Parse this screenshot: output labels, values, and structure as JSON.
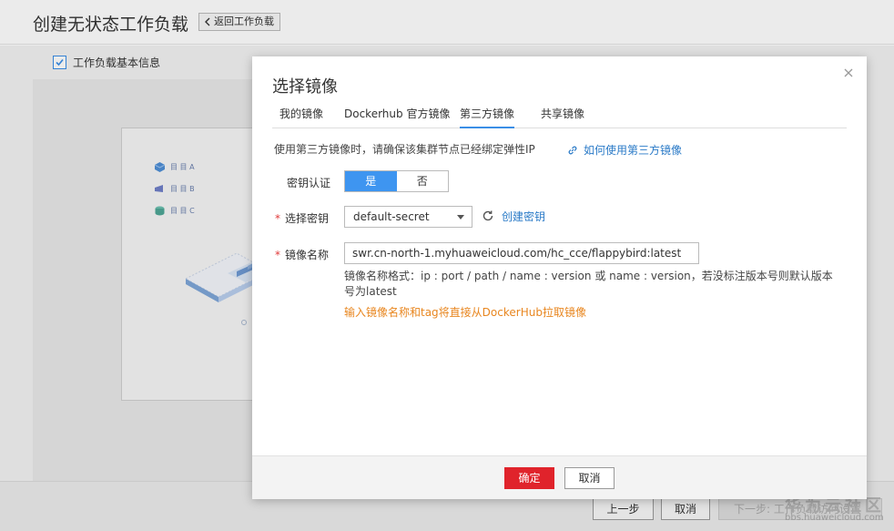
{
  "page": {
    "title": "创建无状态工作负载",
    "back_label": "返回工作负载",
    "step_label": "工作负载基本信息",
    "legend": [
      "目 目 A",
      "目 目 B",
      "目 目 C"
    ],
    "footer": {
      "prev_label": "上一步",
      "cancel_label": "取消",
      "next_label": "下一步: 工作负载访问设置"
    }
  },
  "watermark": {
    "main": "华为云社区",
    "sub": "bbs.huaweicloud.com"
  },
  "modal": {
    "title": "选择镜像",
    "tabs": [
      {
        "label": "我的镜像",
        "active": false
      },
      {
        "label": "Dockerhub 官方镜像",
        "active": false
      },
      {
        "label": "第三方镜像",
        "active": true
      },
      {
        "label": "共享镜像",
        "active": false
      }
    ],
    "hint": "使用第三方镜像时，请确保该集群节点已经绑定弹性IP",
    "help_link": "如何使用第三方镜像",
    "secret_auth": {
      "label": "密钥认证",
      "yes": "是",
      "no": "否",
      "selected": "是"
    },
    "secret_select": {
      "label": "选择密钥",
      "value": "default-secret",
      "create_link": "创建密钥"
    },
    "image_name": {
      "label": "镜像名称",
      "value": "swr.cn-north-1.myhuaweicloud.com/hc_cce/flappybird:latest",
      "format_note": "镜像名称格式：ip : port / path / name : version 或 name : version，若没标注版本号则默认版本号为latest",
      "warning": "输入镜像名称和tag将直接从DockerHub拉取镜像"
    },
    "ok_label": "确定",
    "cancel_label": "取消"
  },
  "colors": {
    "accent": "#3a8ee6",
    "primary_button": "#e0232b",
    "link": "#2a7ac7",
    "warning": "#e8861f"
  }
}
